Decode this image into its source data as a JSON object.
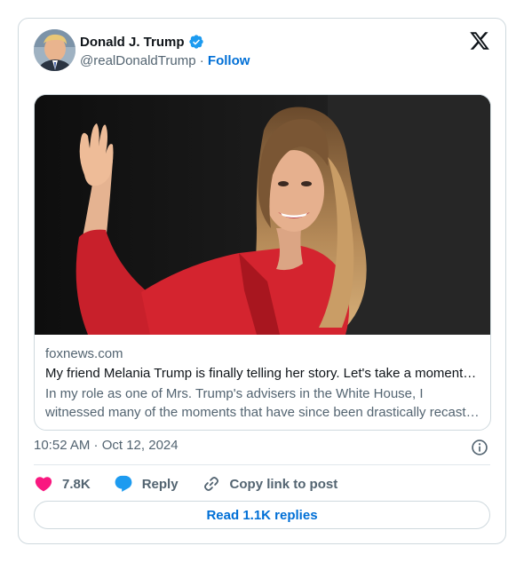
{
  "author": {
    "name": "Donald J. Trump",
    "handle": "@realDonaldTrump",
    "separator": "·",
    "follow_label": "Follow",
    "verified_color": "#1d9bf0"
  },
  "brand_icon": "x-logo-icon",
  "link_card": {
    "image_icon": "photo-woman-waving-red-jacket",
    "domain": "foxnews.com",
    "title": "My friend Melania Trump is finally telling her story. Let's take a moment to listen.",
    "description": "In my role as one of Mrs. Trump's advisers in the White House, I witnessed many of the moments that have since been drastically recast by the media and others."
  },
  "timestamp": "10:52 AM · Oct 12, 2024",
  "actions": {
    "like_count": "7.8K",
    "reply_label": "Reply",
    "copy_label": "Copy link to post"
  },
  "read_replies_label": "Read 1.1K replies",
  "colors": {
    "like": "#f91880",
    "reply": "#1d9bf0",
    "link": "#006fd6",
    "muted": "#536471"
  }
}
